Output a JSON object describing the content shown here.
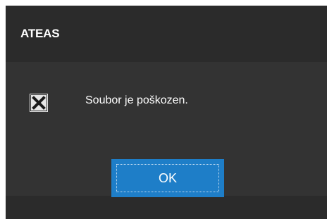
{
  "dialog": {
    "title": "ATEAS",
    "icon": "error-x-icon",
    "message": "Soubor je poškozen.",
    "ok_label": "OK"
  },
  "colors": {
    "background": "#2b2b2b",
    "body": "#333333",
    "button": "#1e7ec8",
    "text": "#ffffff"
  }
}
